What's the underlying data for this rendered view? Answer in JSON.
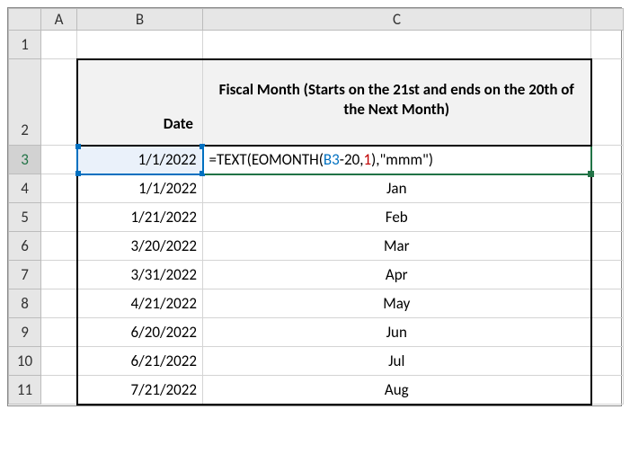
{
  "columns": [
    "A",
    "B",
    "C"
  ],
  "rows": [
    "1",
    "2",
    "3",
    "4",
    "5",
    "6",
    "7",
    "8",
    "9",
    "10",
    "11"
  ],
  "header": {
    "b2": "Date",
    "c2": "Fiscal Month\n(Starts on the 21st and ends on the 20th of the Next Month)"
  },
  "formula": {
    "prefix": "=TEXT(EOMONTH(",
    "ref": "B3",
    "mid1": "-20,",
    "arg2": "1",
    "mid2": "),\"mmm\")"
  },
  "data": [
    {
      "row": "3",
      "date": "1/1/2022",
      "month_display": "formula"
    },
    {
      "row": "4",
      "date": "1/1/2022",
      "month": "Jan"
    },
    {
      "row": "5",
      "date": "1/21/2022",
      "month": "Feb"
    },
    {
      "row": "6",
      "date": "3/20/2022",
      "month": "Mar"
    },
    {
      "row": "7",
      "date": "3/31/2022",
      "month": "Apr"
    },
    {
      "row": "8",
      "date": "4/21/2022",
      "month": "May"
    },
    {
      "row": "9",
      "date": "6/20/2022",
      "month": "Jun"
    },
    {
      "row": "10",
      "date": "6/21/2022",
      "month": "Jul"
    },
    {
      "row": "11",
      "date": "7/21/2022",
      "month": "Aug"
    }
  ],
  "chart_data": {
    "type": "table",
    "title": "Fiscal Month lookup",
    "columns": [
      "Date",
      "Fiscal Month"
    ],
    "rows": [
      [
        "1/1/2022",
        "Jan"
      ],
      [
        "1/1/2022",
        "Jan"
      ],
      [
        "1/21/2022",
        "Feb"
      ],
      [
        "3/20/2022",
        "Mar"
      ],
      [
        "3/31/2022",
        "Apr"
      ],
      [
        "4/21/2022",
        "May"
      ],
      [
        "6/20/2022",
        "Jun"
      ],
      [
        "6/21/2022",
        "Jul"
      ],
      [
        "7/21/2022",
        "Aug"
      ]
    ],
    "formula_in_C3": "=TEXT(EOMONTH(B3-20,1),\"mmm\")"
  }
}
